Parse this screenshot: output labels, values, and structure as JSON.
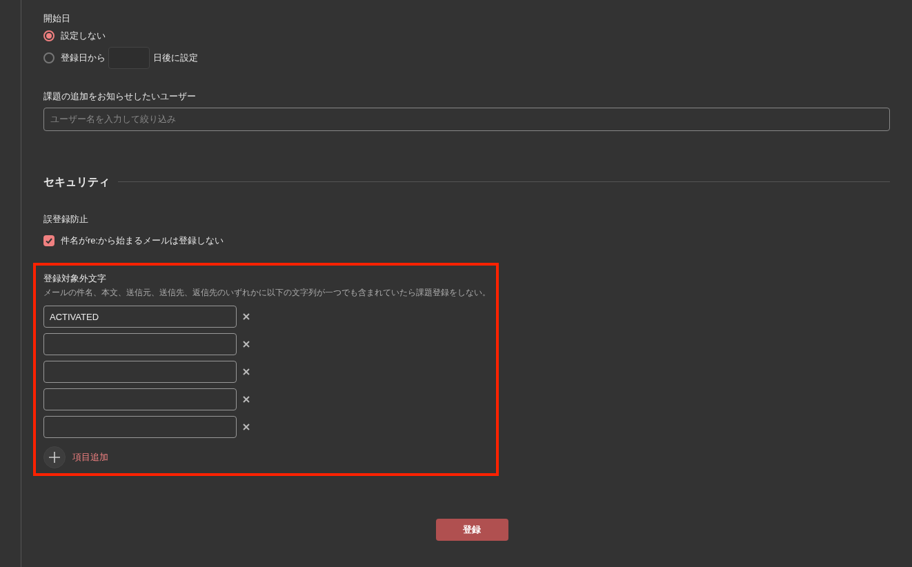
{
  "start_date": {
    "label": "開始日",
    "options": [
      {
        "kind": "plain",
        "selected": true,
        "label": "設定しない"
      },
      {
        "kind": "days",
        "selected": false,
        "label": "登録日から",
        "suffix": "日後に設定"
      }
    ]
  },
  "notify_users": {
    "label": "課題の追加をお知らせしたいユーザー",
    "placeholder": "ユーザー名を入力して絞り込み"
  },
  "security": {
    "heading": "セキュリティ",
    "prevent": {
      "label": "誤登録防止",
      "checkbox": {
        "checked": true,
        "label": "件名がre:から始まるメールは登録しない"
      }
    },
    "excluded": {
      "label": "登録対象外文字",
      "description": "メールの件名、本文、送信元、送信先、返信先のいずれかに以下の文字列が一つでも含まれていたら課題登録をしない。",
      "entries": [
        {
          "kind": "filled",
          "value": "ACTIVATED"
        },
        {
          "kind": "empty"
        },
        {
          "kind": "empty"
        },
        {
          "kind": "empty"
        },
        {
          "kind": "empty"
        }
      ],
      "add_label": "項目追加"
    }
  },
  "submit": "登録"
}
